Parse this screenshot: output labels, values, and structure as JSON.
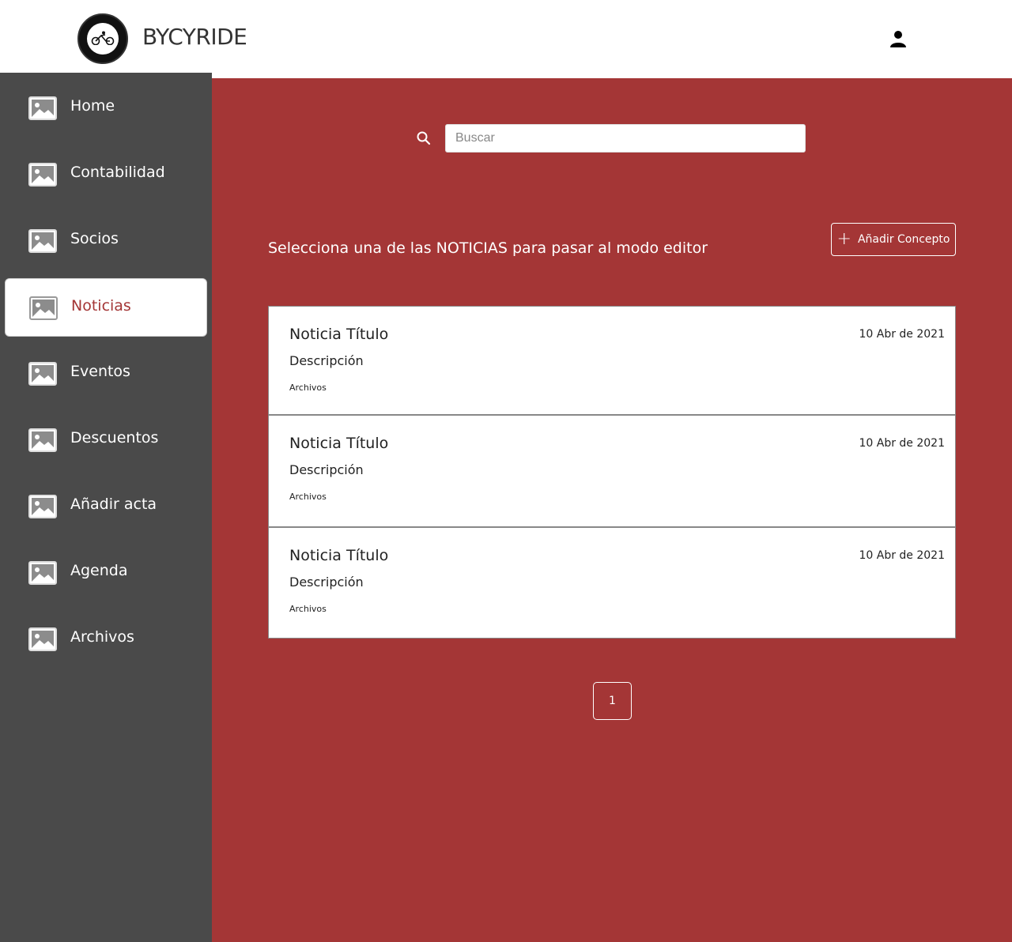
{
  "header": {
    "brand": "BYCYRIDE",
    "logo_icon": "club-logo-icon",
    "user_icon": "user-icon"
  },
  "colors": {
    "accent": "#a43636",
    "sidebar": "#4a4a4a",
    "header_bg": "#ffffff"
  },
  "sidebar": {
    "items": [
      {
        "label": "Home",
        "icon": "image-icon",
        "active": false
      },
      {
        "label": "Contabilidad",
        "icon": "image-icon",
        "active": false
      },
      {
        "label": "Socios",
        "icon": "image-icon",
        "active": false
      },
      {
        "label": "Noticias",
        "icon": "image-icon",
        "active": true
      },
      {
        "label": "Eventos",
        "icon": "image-icon",
        "active": false
      },
      {
        "label": "Descuentos",
        "icon": "image-icon",
        "active": false
      },
      {
        "label": "Añadir acta",
        "icon": "image-icon",
        "active": false
      },
      {
        "label": "Agenda",
        "icon": "image-icon",
        "active": false
      },
      {
        "label": "Archivos",
        "icon": "image-icon",
        "active": false
      }
    ]
  },
  "search": {
    "placeholder": "Buscar",
    "value": ""
  },
  "main": {
    "instruction": "Selecciona una de las NOTICIAS para pasar al modo editor",
    "add_button_label": "Añadir Concepto",
    "news": [
      {
        "title": "Noticia Título",
        "date": "10 Abr de  2021",
        "description": "Descripción",
        "files": "Archivos"
      },
      {
        "title": "Noticia Título",
        "date": "10 Abr de  2021",
        "description": "Descripción",
        "files": "Archivos"
      },
      {
        "title": "Noticia Título",
        "date": "10 Abr de  2021",
        "description": "Descripción",
        "files": "Archivos"
      }
    ],
    "pagination": {
      "current": "1"
    }
  }
}
